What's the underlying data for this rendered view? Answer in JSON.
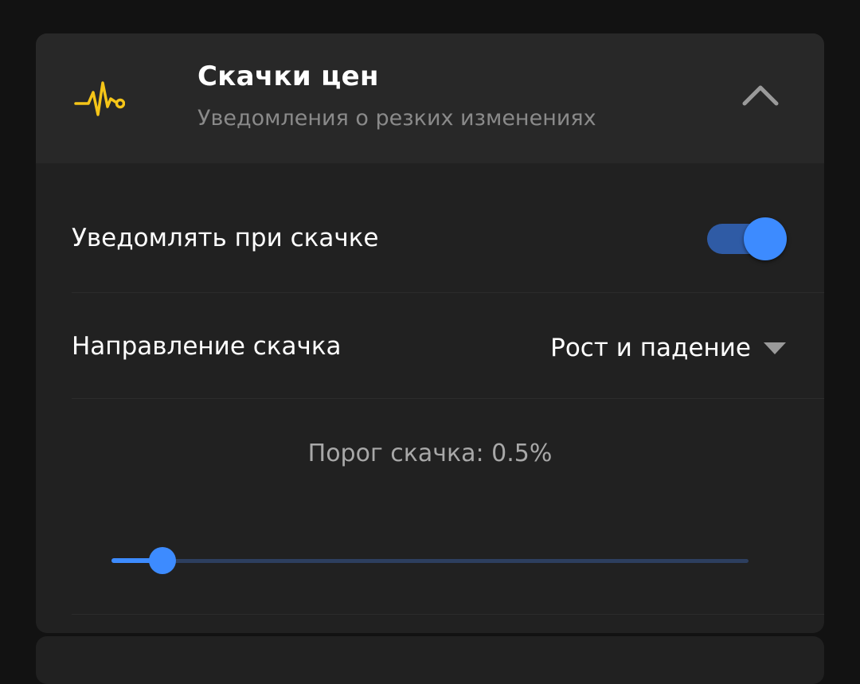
{
  "header": {
    "title": "Скачки цен",
    "subtitle": "Уведомления о резких изменениях",
    "icon": "pulse-icon",
    "icon_color": "#f5c518",
    "collapse_icon": "chevron-up-icon"
  },
  "notify_row": {
    "label": "Уведомлять при скачке",
    "enabled": true
  },
  "direction_row": {
    "label": "Направление скачка",
    "value": "Рост и падение",
    "dropdown_icon": "triangle-down-icon"
  },
  "threshold": {
    "label": "Порог скачка: 0.5%",
    "slider_fraction": 0.08
  },
  "colors": {
    "accent": "#3d8bff",
    "icon_yellow": "#f5c518"
  }
}
